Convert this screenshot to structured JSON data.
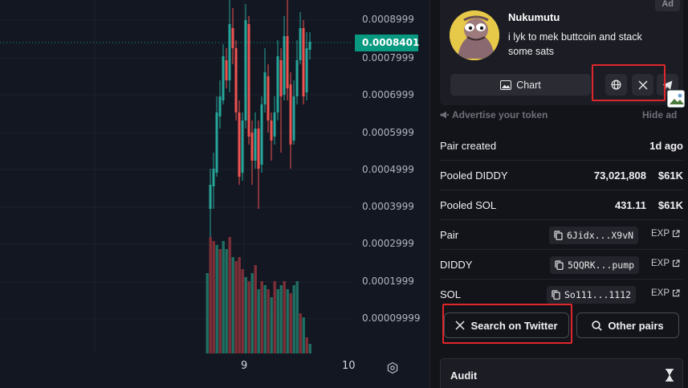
{
  "chart": {
    "price_ticks": [
      "0.0008999",
      "0.0007999",
      "0.0006999",
      "0.0005999",
      "0.0004999",
      "0.0003999",
      "0.0002999",
      "0.0001999",
      "0.00009999"
    ],
    "current_price": "0.0008401",
    "x_ticks": [
      "9",
      "10"
    ],
    "colors": {
      "up": "#26a69a",
      "down": "#ef5350",
      "vol_up": "#1f6f63",
      "vol_down": "#7e2f37",
      "bg": "#131722",
      "grid": "#1e222d"
    }
  },
  "token": {
    "ad_label": "Ad",
    "name": "Nukumutu",
    "description": "i lyk to mek buttcoin and stack some sats",
    "chart_button_label": "Chart",
    "avatar_icon": "cartoon-avatar-icon",
    "social_icons": [
      "globe-icon",
      "x-twitter-icon",
      "telegram-icon"
    ]
  },
  "ad_bar": {
    "advertise_label": "Advertise your token",
    "hide_label": "Hide ad"
  },
  "info": {
    "pair_created_label": "Pair created",
    "pair_created_value": "1d ago",
    "pooled_token_label": "Pooled DIDDY",
    "pooled_token_amount": "73,021,808",
    "pooled_token_usd": "$61K",
    "pooled_sol_label": "Pooled SOL",
    "pooled_sol_amount": "431.11",
    "pooled_sol_usd": "$61K",
    "pair_label": "Pair",
    "pair_address": "6Jidx...X9vN",
    "token_label": "DIDDY",
    "token_address": "5QQRK...pump",
    "sol_label": "SOL",
    "sol_address": "So111...1112",
    "exp_label": "EXP"
  },
  "actions": {
    "search_twitter_label": "Search on Twitter",
    "other_pairs_label": "Other pairs"
  },
  "audit": {
    "title": "Audit"
  }
}
